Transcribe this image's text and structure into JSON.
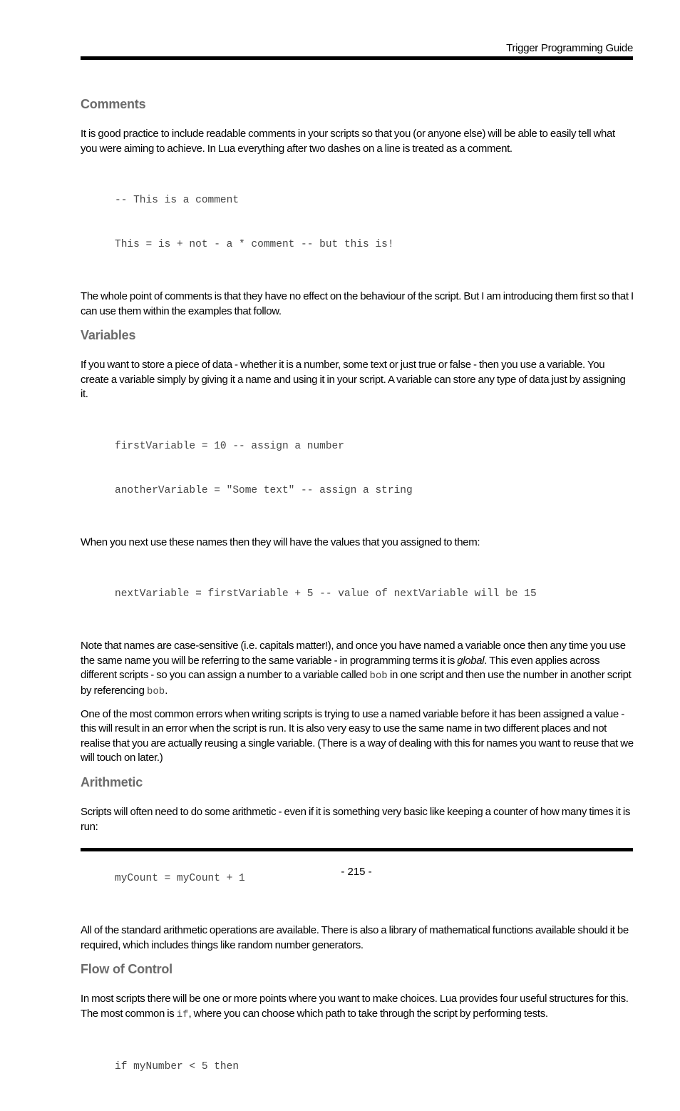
{
  "header": {
    "title": "Trigger Programming Guide"
  },
  "sections": [
    {
      "heading": "Comments",
      "p1": "It is good practice to include readable comments in your scripts so that you (or anyone else) will be able to easily tell what you were aiming to achieve. In Lua everything after two dashes on a line is treated as a comment.",
      "code": [
        "-- This is a comment",
        "This = is + not - a * comment -- but this is!"
      ],
      "p2": "The whole point of comments is that they have no effect on the behaviour of the script. But I am introducing them first so that I can use them within the examples that follow."
    },
    {
      "heading": "Variables",
      "p1": "If you want to store a piece of data - whether it is a number, some text or just true or false - then you use a vari­able. You create a variable simply by giving it a name and using it in your script. A variable can store any type of data just by assigning it.",
      "code": [
        "firstVariable = 10 -- assign a number",
        "anotherVariable = \"Some text\" -- assign a string"
      ],
      "p2": "When you next use these names then they will have the values that you assigned to them:",
      "code2": [
        "nextVariable = firstVariable + 5 -- value of nextVariable will be 15"
      ],
      "p3_a": "Note that names are case-sensitive (i.e. capitals matter!), and once you have named a variable once then any time you use the same name you will be referring to the same variable - in programming terms it is ",
      "p3_em": "global",
      "p3_b": ". This even applies across different scripts - so you can assign a number to a variable called ",
      "p3_code1": "bob",
      "p3_c": " in one script and then use the number in another script by referencing ",
      "p3_code2": "bob",
      "p3_d": ".",
      "p4": "One of the most common errors when writing scripts is trying to use a named variable before it has been assigned a value - this will result in an error when the script is run. It is also very easy to use the same name in two different places and not realise that you are actually reusing a single variable. (There is a way of dealing with this for names you want to reuse that we will touch on later.)"
    },
    {
      "heading": "Arithmetic",
      "p1": "Scripts will often need to do some arithmetic - even if it is something very basic like keeping a counter of how many times it is run:",
      "code": [
        "myCount = myCount + 1"
      ],
      "p2": "All of the standard arithmetic operations are available. There is also a library of mathematical functions available should it be required, which includes things like random number generators."
    },
    {
      "heading": "Flow of Control",
      "p1_a": "In most scripts there will be one or more points where you want to make choices. Lua provides four useful struc­tures for this. The most common is ",
      "p1_code": "if",
      "p1_b": ", where you can choose which path to take through the script by performing tests.",
      "code": [
        "if myNumber < 5 then"
      ]
    }
  ],
  "footer": {
    "page_number": "- 215 -"
  }
}
